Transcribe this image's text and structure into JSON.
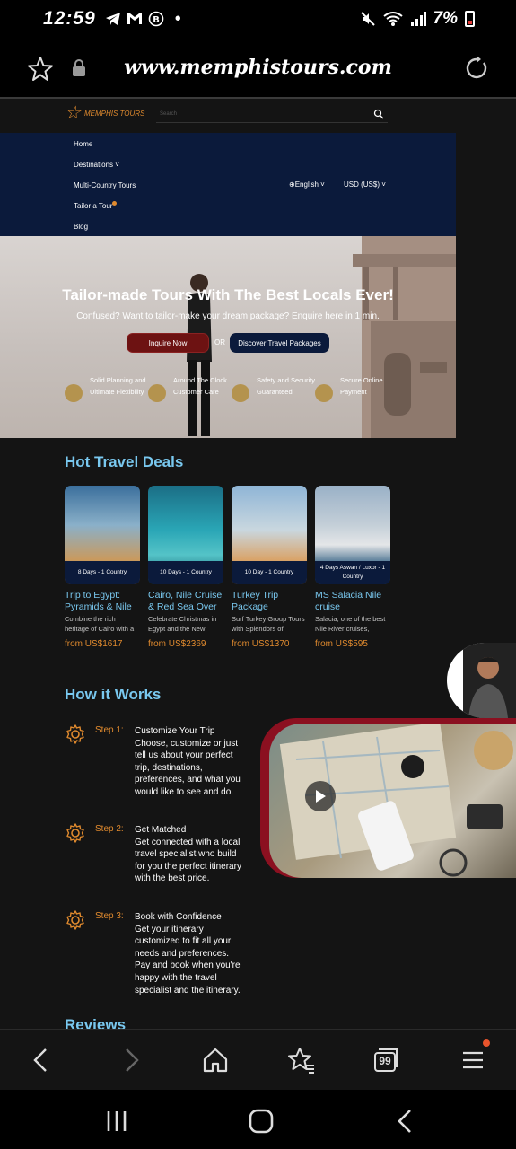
{
  "status": {
    "time": "12:59",
    "battery": "7%"
  },
  "browser": {
    "url": "www.memphistours.com"
  },
  "site": {
    "logo_text": "MEMPHIS TOURS",
    "search_placeholder": "Search",
    "nav": [
      "Home",
      "Destinations ˅",
      "Multi-Country Tours",
      "Tailor a Tour",
      "Blog"
    ],
    "language": "English ˅",
    "currency": "USD (US$) ˅"
  },
  "hero": {
    "title": "Tailor-made Tours With The Best Locals Ever!",
    "subtitle": "Confused? Want to tailor-make your dream package? Enquire here in 1 min.",
    "inquire_label": "Inquire Now",
    "or_label": "OR",
    "discover_label": "Discover Travel Packages",
    "features": [
      {
        "text": "Solid Planning and Ultimate Flexibility"
      },
      {
        "text": "Around The Clock Customer Care"
      },
      {
        "text": "Safety and Security Guaranteed"
      },
      {
        "text": "Secure Online Payment"
      }
    ]
  },
  "deals": {
    "heading": "Hot Travel Deals",
    "items": [
      {
        "badge": "8 Days - 1 Country",
        "name": "Trip to Egypt: Pyramids & Nile",
        "desc": "Combine the rich heritage of Cairo with a",
        "price": "from US$1617"
      },
      {
        "badge": "10 Days - 1 Country",
        "name": "Cairo, Nile Cruise & Red Sea Over",
        "desc": "Celebrate Christmas in Egypt and the New",
        "price": "from US$2369"
      },
      {
        "badge": "10 Day - 1 Country",
        "name": "Turkey Trip Package",
        "desc": "Surf Turkey Group Tours with Splendors of",
        "price": "from US$1370"
      },
      {
        "badge": "4 Days Aswan / Luxor - 1 Country",
        "name": "MS Salacia Nile cruise",
        "desc": "Salacia, one of the best Nile River cruises,",
        "price": "from US$595"
      }
    ]
  },
  "how": {
    "heading": "How it Works",
    "steps": [
      {
        "label": "Step 1:",
        "title": "Customize Your Trip",
        "text": "Choose, customize or just tell us about your perfect trip, destinations, preferences, and what you would like to see and do."
      },
      {
        "label": "Step 2:",
        "title": "Get Matched",
        "text": "Get connected with a local travel specialist who build for you the perfect itinerary with the best price."
      },
      {
        "label": "Step 3:",
        "title": "Book with Confidence",
        "text": "Get your itinerary customized to fit all your needs and preferences. Pay and book when you're happy with the travel specialist and the itinerary."
      }
    ]
  },
  "reviews": {
    "heading": "Reviews"
  },
  "colors": {
    "navy": "#0b1a3b",
    "accent_blue": "#79c8ef",
    "orange": "#e08a2e",
    "maroon": "#6d1212"
  },
  "bottom_bar": {
    "tab_count": "99"
  }
}
